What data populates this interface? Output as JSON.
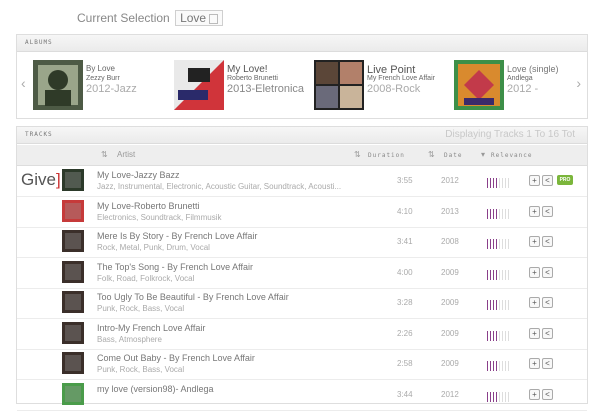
{
  "selection": {
    "label": "Current Selection",
    "value": "Love"
  },
  "albums_panel": {
    "header": "ALBUMS",
    "items": [
      {
        "title": "By Love",
        "artist": "Zezzy Burr",
        "meta": "2012-Jazz"
      },
      {
        "title": "My Love!",
        "artist": "Roberto Brunetti",
        "meta": "2013-Eletronica"
      },
      {
        "title": "Live Point",
        "artist": "My French Love Affair",
        "meta": "2008-Rock"
      },
      {
        "title": "Love (single)",
        "artist": "Andlega",
        "meta": "2012 -"
      }
    ]
  },
  "tracks_panel": {
    "header": "TRACKS",
    "status": "Displaying Tracks 1 To 16 Tot",
    "columns": {
      "artist": "Artist",
      "duration": "Duration",
      "date": "Date",
      "relevance": "Relevance"
    },
    "give_label": {
      "part1": "Give",
      "part2": "]"
    },
    "pro_label": "PRO",
    "rows": [
      {
        "title": "My Love-Jazzy Bazz",
        "sub": "Jazz, Instrumental, Electronic, Acoustic Guitar, Soundtrack, Acousti...",
        "duration": "3:55",
        "date": "2012",
        "relevance": 4,
        "pro": true,
        "thumb": "#2c3a2a"
      },
      {
        "title": "My Love-Roberto Brunetti",
        "sub": "Electronics, Soundtrack, Filmmusik",
        "duration": "4:10",
        "date": "2013",
        "relevance": 4,
        "pro": false,
        "thumb": "#c63a3a"
      },
      {
        "title": "Mere Is By Story - By French Love Affair",
        "sub": "Rock, Metal, Punk, Drum, Vocal",
        "duration": "3:41",
        "date": "2008",
        "relevance": 4,
        "pro": false,
        "thumb": "#3b2f2a"
      },
      {
        "title": "The Top's Song - By French Love Affair",
        "sub": "Folk, Road, Folkrock, Vocal",
        "duration": "4:00",
        "date": "2009",
        "relevance": 4,
        "pro": false,
        "thumb": "#3b2f2a"
      },
      {
        "title": "Too Ugly To Be Beautiful - By French Love Affair",
        "sub": "Punk, Rock, Bass, Vocal",
        "duration": "3:28",
        "date": "2009",
        "relevance": 4,
        "pro": false,
        "thumb": "#3b2f2a"
      },
      {
        "title": "Intro-My French Love Affair",
        "sub": "Bass, Atmosphere",
        "duration": "2:26",
        "date": "2009",
        "relevance": 4,
        "pro": false,
        "thumb": "#3b2f2a"
      },
      {
        "title": "Come Out Baby - By French Love Affair",
        "sub": "Punk, Rock, Bass, Vocal",
        "duration": "2:58",
        "date": "2009",
        "relevance": 4,
        "pro": false,
        "thumb": "#3b2f2a"
      },
      {
        "title": "my love (version98)- Andlega",
        "sub": "",
        "duration": "3:44",
        "date": "2012",
        "relevance": 4,
        "pro": false,
        "thumb": "#4a9c4a"
      }
    ]
  }
}
